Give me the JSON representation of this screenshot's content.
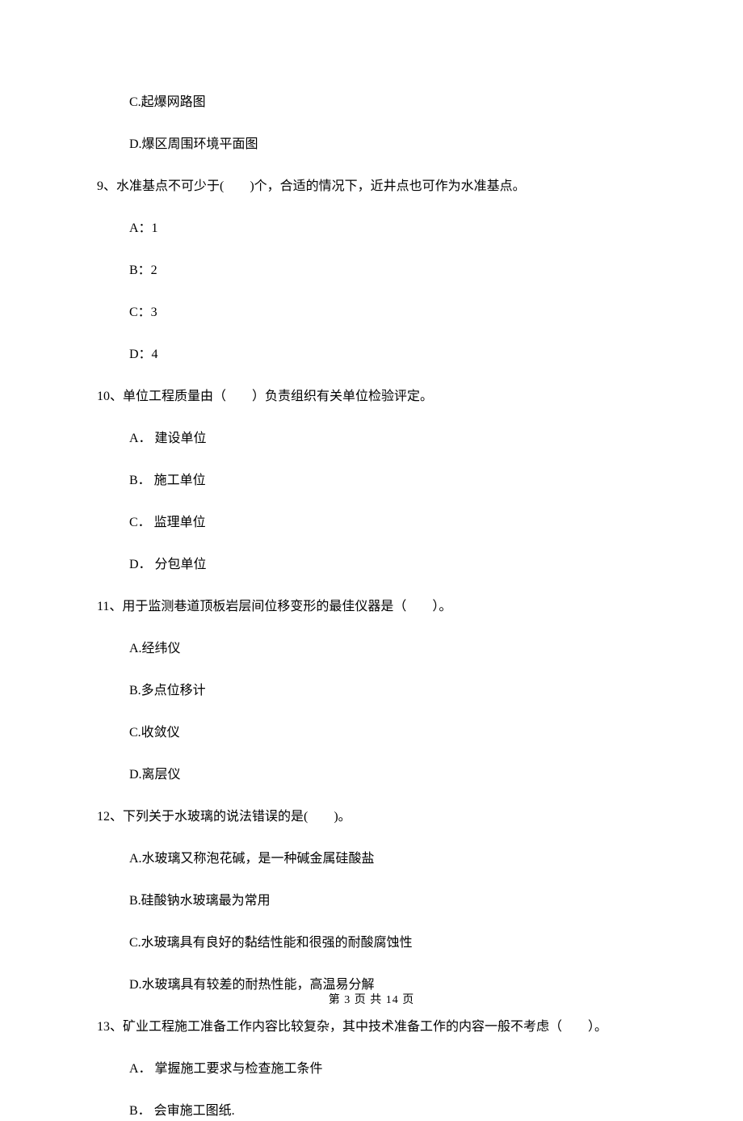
{
  "options_top": [
    "C.起爆网路图",
    "D.爆区周围环境平面图"
  ],
  "q9": {
    "text": "9、水准基点不可少于(　　)个，合适的情况下，近井点也可作为水准基点。",
    "opts": [
      "A：1",
      "B：2",
      "C：3",
      "D：4"
    ]
  },
  "q10": {
    "text": "10、单位工程质量由（　　）负责组织有关单位检验评定。",
    "opts": [
      "A． 建设单位",
      "B． 施工单位",
      "C． 监理单位",
      "D． 分包单位"
    ]
  },
  "q11": {
    "text": "11、用于监测巷道顶板岩层间位移变形的最佳仪器是（　　）。",
    "opts": [
      "A.经纬仪",
      "B.多点位移计",
      "C.收敛仪",
      "D.离层仪"
    ]
  },
  "q12": {
    "text": "12、下列关于水玻璃的说法错误的是(　　)。",
    "opts": [
      "A.水玻璃又称泡花碱，是一种碱金属硅酸盐",
      "B.硅酸钠水玻璃最为常用",
      "C.水玻璃具有良好的黏结性能和很强的耐酸腐蚀性",
      "D.水玻璃具有较差的耐热性能，高温易分解"
    ]
  },
  "q13": {
    "text": "13、矿业工程施工准备工作内容比较复杂，其中技术准备工作的内容一般不考虑（　　）。",
    "opts": [
      "A． 掌握施工要求与检查施工条件",
      "B． 会审施工图纸."
    ]
  },
  "footer": "第 3 页 共 14 页"
}
